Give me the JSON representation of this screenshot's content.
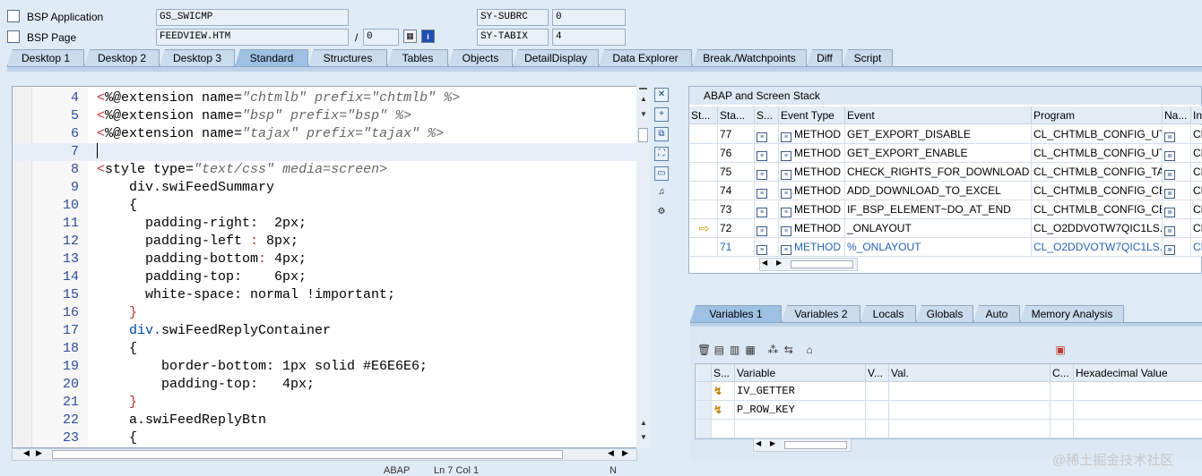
{
  "header": {
    "bsp_application_label": "BSP Application",
    "bsp_application_value": "GS_SWICMP",
    "bsp_page_label": "BSP Page",
    "bsp_page_value": "FEEDVIEW.HTM",
    "page_separator": "/",
    "page_number": "0",
    "sy_subrc_label": "SY-SUBRC",
    "sy_subrc_value": "0",
    "sy_tabix_label": "SY-TABIX",
    "sy_tabix_value": "4"
  },
  "tabs": [
    "Desktop 1",
    "Desktop 2",
    "Desktop 3",
    "Standard",
    "Structures",
    "Tables",
    "Objects",
    "DetailDisplay",
    "Data Explorer",
    "Break./Watchpoints",
    "Diff",
    "Script"
  ],
  "active_tab": "Standard",
  "editor": {
    "lines": [
      {
        "n": "4",
        "segs": [
          [
            "br",
            "<"
          ],
          [
            "",
            "%@extension name="
          ],
          [
            "it",
            "\"chtmlb\" prefix=\"chtmlb\" %>"
          ]
        ]
      },
      {
        "n": "5",
        "segs": [
          [
            "br",
            "<"
          ],
          [
            "",
            "%@extension name="
          ],
          [
            "it",
            "\"bsp\" prefix=\"bsp\" %>"
          ]
        ]
      },
      {
        "n": "6",
        "segs": [
          [
            "br",
            "<"
          ],
          [
            "",
            "%@extension name="
          ],
          [
            "it",
            "\"tajax\" prefix=\"tajax\" %>"
          ]
        ]
      },
      {
        "n": "7",
        "segs": [
          [
            "",
            ""
          ]
        ]
      },
      {
        "n": "8",
        "segs": [
          [
            "br",
            "<"
          ],
          [
            "",
            "style type="
          ],
          [
            "it",
            "\"text/css\" media=screen>"
          ]
        ]
      },
      {
        "n": "9",
        "segs": [
          [
            "",
            "    div.swiFeedSummary"
          ]
        ]
      },
      {
        "n": "10",
        "segs": [
          [
            "",
            "    {"
          ]
        ]
      },
      {
        "n": "11",
        "segs": [
          [
            "",
            "      padding-right:  2px;"
          ]
        ]
      },
      {
        "n": "12",
        "segs": [
          [
            "",
            "      padding-left "
          ],
          [
            "br",
            ":"
          ],
          [
            "",
            " 8px;"
          ]
        ]
      },
      {
        "n": "13",
        "segs": [
          [
            "",
            "      padding-bottom"
          ],
          [
            "br",
            ":"
          ],
          [
            "",
            " 4px;"
          ]
        ]
      },
      {
        "n": "14",
        "segs": [
          [
            "",
            "      padding-top:    6px;"
          ]
        ]
      },
      {
        "n": "15",
        "segs": [
          [
            "",
            "      white-space: normal !important;"
          ]
        ]
      },
      {
        "n": "16",
        "segs": [
          [
            "br",
            "    }"
          ]
        ]
      },
      {
        "n": "17",
        "segs": [
          [
            "bl",
            "    div."
          ],
          [
            "",
            "swiFeedReplyContainer"
          ]
        ]
      },
      {
        "n": "18",
        "segs": [
          [
            "",
            "    {"
          ]
        ]
      },
      {
        "n": "19",
        "segs": [
          [
            "",
            "        border-bottom: 1px solid #E6E6E6;"
          ]
        ]
      },
      {
        "n": "20",
        "segs": [
          [
            "",
            "        padding-top:   4px;"
          ]
        ]
      },
      {
        "n": "21",
        "segs": [
          [
            "br",
            "    }"
          ]
        ]
      },
      {
        "n": "22",
        "segs": [
          [
            "",
            "    a.swiFeedReplyBtn"
          ]
        ]
      },
      {
        "n": "23",
        "segs": [
          [
            "",
            "    {"
          ]
        ]
      }
    ],
    "cursor_line": "7",
    "status_lang": "ABAP",
    "status_pos": "Ln  7 Col  1",
    "status_mode": "N"
  },
  "stack": {
    "title": "ABAP and Screen Stack",
    "columns": [
      "St...",
      "Sta...",
      "S...",
      "Event Type",
      "Event",
      "Program",
      "Na...",
      "In"
    ],
    "rows": [
      {
        "mark": "",
        "level": "77",
        "type": "METHOD",
        "event": "GET_EXPORT_DISABLE",
        "program": "CL_CHTMLB_CONFIG_UT...",
        "inc": "CL"
      },
      {
        "mark": "",
        "level": "76",
        "type": "METHOD",
        "event": "GET_EXPORT_ENABLE",
        "program": "CL_CHTMLB_CONFIG_UT...",
        "inc": "CL"
      },
      {
        "mark": "",
        "level": "75",
        "type": "METHOD",
        "event": "CHECK_RIGHTS_FOR_DOWNLOAD",
        "program": "CL_CHTMLB_CONFIG_TA...",
        "inc": "CL"
      },
      {
        "mark": "",
        "level": "74",
        "type": "METHOD",
        "event": "ADD_DOWNLOAD_TO_EXCEL",
        "program": "CL_CHTMLB_CONFIG_CE...",
        "inc": "CL"
      },
      {
        "mark": "",
        "level": "73",
        "type": "METHOD",
        "event": "IF_BSP_ELEMENT~DO_AT_END",
        "program": "CL_CHTMLB_CONFIG_CE...",
        "inc": "CL"
      },
      {
        "mark": "⇨",
        "level": "72",
        "type": "METHOD",
        "event": "_ONLAYOUT",
        "program": "CL_O2DDVOTW7QIC1LS...",
        "inc": "CL"
      },
      {
        "mark": "",
        "level": "71",
        "type": "METHOD",
        "event": "%_ONLAYOUT",
        "program": "CL_O2DDVOTW7QIC1LS...",
        "inc": "CL"
      }
    ],
    "selected_level": "71"
  },
  "var_tabs": [
    "Variables 1",
    "Variables 2",
    "Locals",
    "Globals",
    "Auto",
    "Memory Analysis"
  ],
  "active_var_tab": "Variables 1",
  "vars": {
    "columns": [
      "S...",
      "Variable",
      "V...",
      "Val.",
      "C...",
      "Hexadecimal Value"
    ],
    "rows": [
      {
        "name": "IV_GETTER",
        "value": "",
        "hex": ""
      },
      {
        "name": "P_ROW_KEY",
        "value": "",
        "hex": ""
      }
    ]
  },
  "watermark": "@稀土掘金技术社区"
}
